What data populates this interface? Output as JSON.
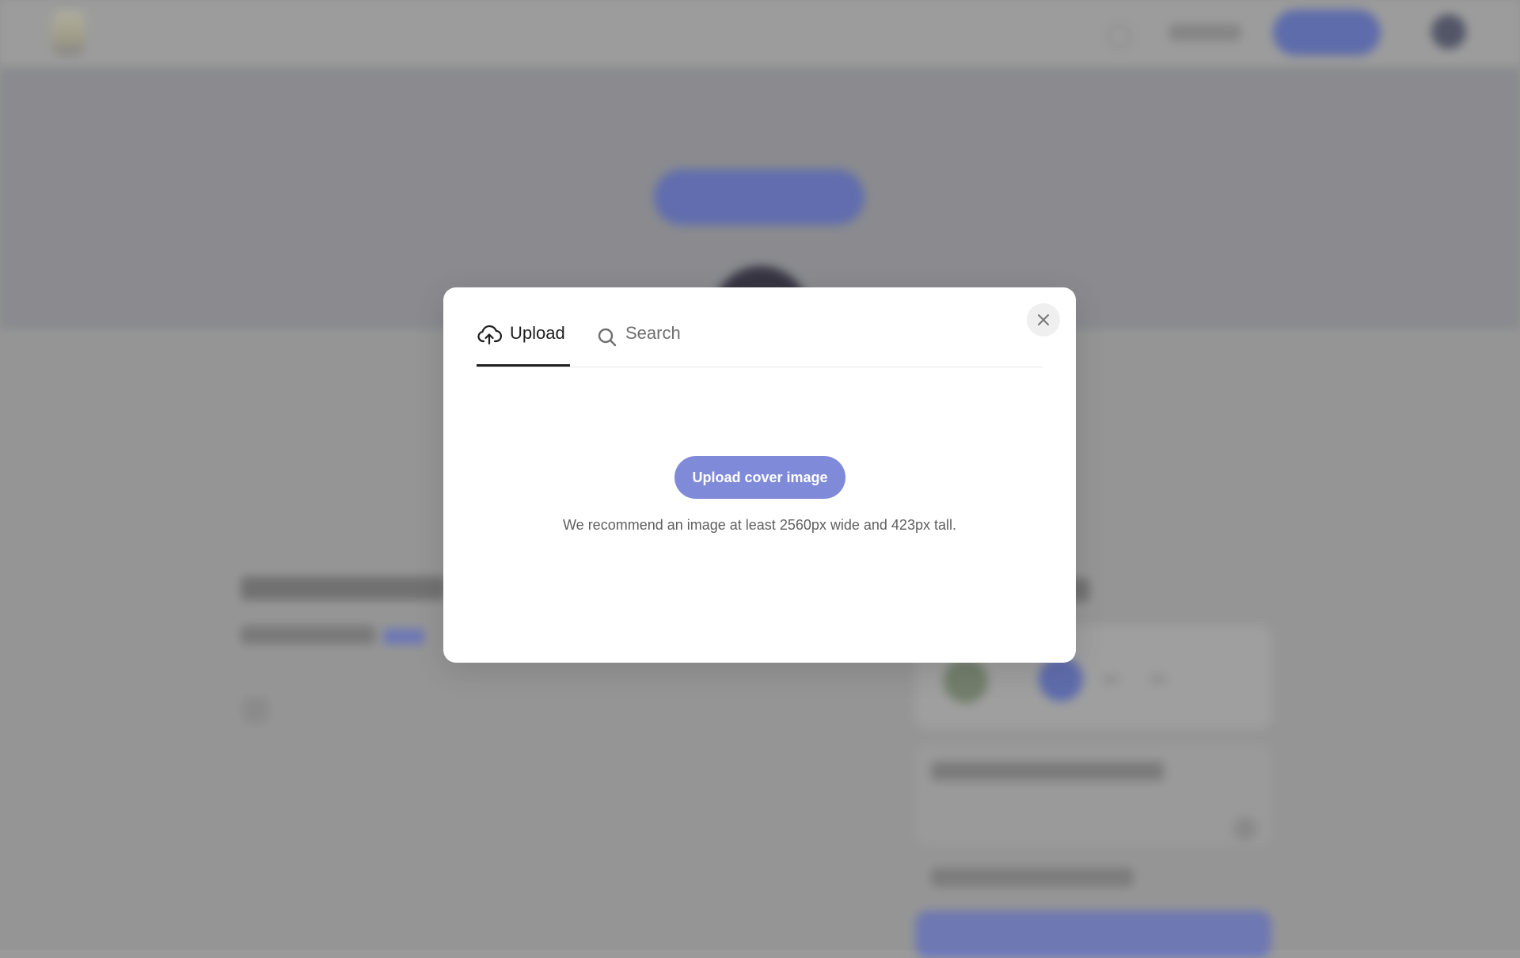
{
  "modal": {
    "tabs": [
      {
        "label": "Upload",
        "icon": "cloud-upload-icon",
        "active": true
      },
      {
        "label": "Search",
        "icon": "search-icon",
        "active": false
      }
    ],
    "upload_button_label": "Upload cover image",
    "hint": "We recommend an image at least 2560px wide and 423px tall.",
    "close_icon": "close-icon"
  },
  "colors": {
    "primary_button": "#7f8ad9",
    "overlay": "#9a9a9a",
    "active_tab_underline": "#1f1f1f"
  }
}
